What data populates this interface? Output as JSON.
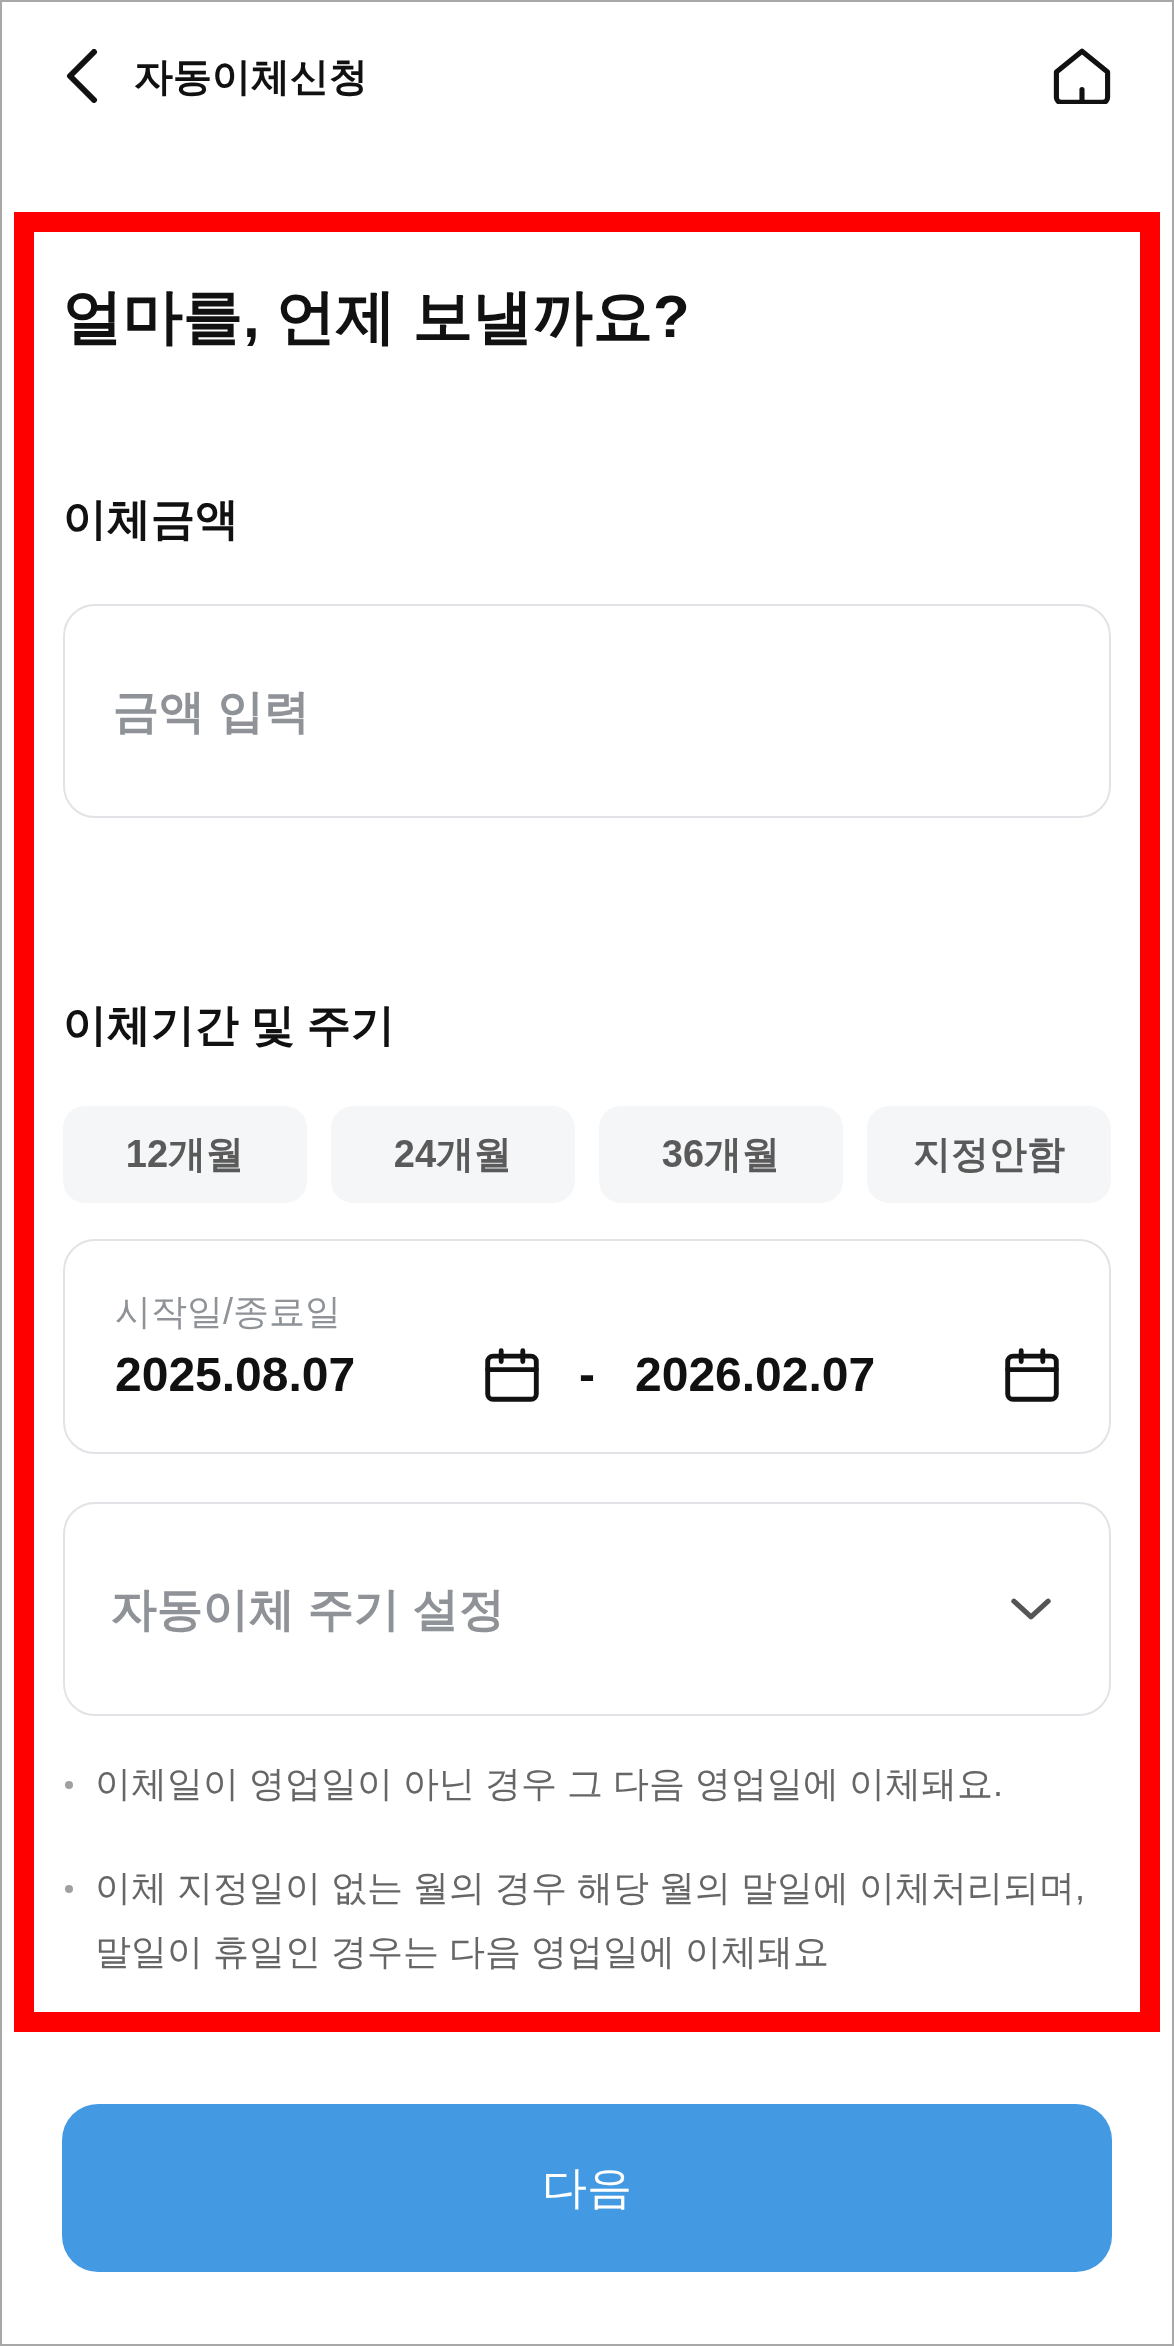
{
  "header": {
    "title": "자동이체신청"
  },
  "heading": "얼마를, 언제 보낼까요?",
  "amount": {
    "label": "이체금액",
    "placeholder": "금액 입력"
  },
  "period": {
    "label": "이체기간 및 주기",
    "presets": [
      {
        "label": "12개월",
        "selected": false
      },
      {
        "label": "24개월",
        "selected": false
      },
      {
        "label": "36개월",
        "selected": false
      },
      {
        "label": "지정안함",
        "selected": false
      }
    ],
    "date_range": {
      "label": "시작일/종료일",
      "start": "2025.08.07",
      "separator": "-",
      "end": "2026.02.07"
    },
    "cycle_select": {
      "placeholder": "자동이체 주기 설정"
    }
  },
  "notes": [
    "이체일이 영업일이 아닌 경우 그 다음 영업일에 이체돼요.",
    "이체 지정일이 없는 월의 경우 해당 월의 말일에 이체처리되며, 말일이 휴일인 경우는 다음 영업일에 이체돼요"
  ],
  "next_button": {
    "label": "다음"
  }
}
